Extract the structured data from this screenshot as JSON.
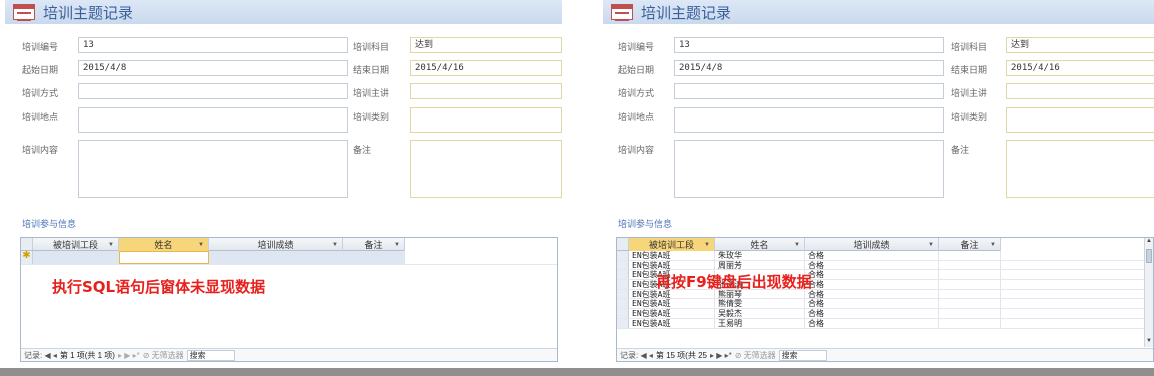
{
  "form": {
    "title": "培训主题记录",
    "labels": {
      "id": "培训编号",
      "subject": "培训科目",
      "start": "起始日期",
      "end": "结束日期",
      "method": "培训方式",
      "lecturer": "培训主讲",
      "location": "培训地点",
      "category": "培训类别",
      "content": "培训内容",
      "remark": "备注"
    },
    "values": {
      "id": "13",
      "subject": "达到",
      "start": "2015/4/8",
      "end": "2015/4/16"
    },
    "section_label": "培训参与信息"
  },
  "grid": {
    "columns": [
      "被培训工段",
      "姓名",
      "培训成绩",
      "备注"
    ],
    "rows_right": [
      [
        "EN包装A班",
        "朱玫华",
        "合格"
      ],
      [
        "EN包装A班",
        "周丽芳",
        "合格"
      ],
      [
        "EN包装A班",
        "",
        "合格"
      ],
      [
        "EN包装A班",
        "张泳涛",
        "合格"
      ],
      [
        "EN包装A班",
        "熊丽琴",
        "合格"
      ],
      [
        "EN包装A班",
        "熊倩雯",
        "合格"
      ],
      [
        "EN包装A班",
        "吴毅杰",
        "合格"
      ],
      [
        "EN包装A班",
        "王易明",
        "合格"
      ]
    ]
  },
  "navbar_left": {
    "prefix": "记录: ◀ ◂",
    "record": "第 1 项(共 1 项)",
    "nav": "▸ ▶ ▸*",
    "filter": "无筛选器",
    "search": "搜索"
  },
  "navbar_right": {
    "prefix": "记录: ◀ ◂",
    "record": "第 15 项(共 25",
    "nav": "▸ ▶ ▸*",
    "filter": "无筛选器",
    "search": "搜索"
  },
  "annotations": {
    "left": "执行SQL语句后窗体未显现数据",
    "right": "再按F9键盘后出现数据"
  },
  "colors": {
    "accent": "#3a5f9a",
    "annotation": "#e8201c",
    "selected_header": "#f7d57a"
  }
}
